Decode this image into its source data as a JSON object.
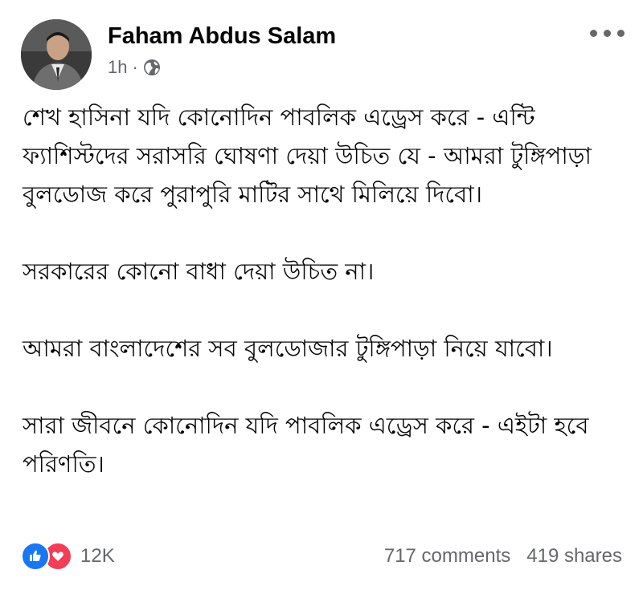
{
  "post": {
    "author_name": "Faham Abdus Salam",
    "time": "1h",
    "separator": "·",
    "audience_icon": "globe-icon",
    "more_icon": "more-options-icon",
    "paragraphs": [
      "শেখ হাসিনা যদি কোনোদিন পাবলিক এড্রেস করে - এন্টি ফ্যাশিস্টদের সরাসরি ঘোষণা দেয়া উচিত যে - আমরা টুঙ্গিপাড়া বুলডোজ করে পুরাপুরি মাটির সাথে মিলিয়ে দিবো।",
      "সরকারের কোনো বাধা দেয়া উচিত না।",
      "আমরা বাংলাদেশের সব বুলডোজার টুঙ্গিপাড়া নিয়ে যাবো।",
      "সারা জীবনে কোনোদিন যদি পাবলিক এড্রেস করে - এইটা হবে পরিণতি।"
    ]
  },
  "footer": {
    "reaction_icons": [
      "like-icon",
      "love-icon"
    ],
    "reaction_count": "12K",
    "comments": "717 comments",
    "shares": "419 shares"
  },
  "colors": {
    "like_blue": "#1877f2",
    "love_red": "#f33e58",
    "secondary_text": "#65676b",
    "primary_text": "#050505"
  }
}
